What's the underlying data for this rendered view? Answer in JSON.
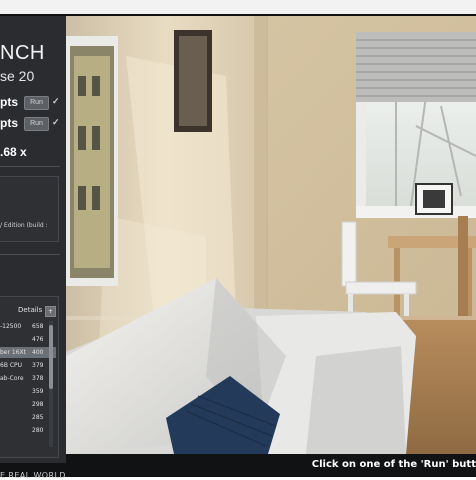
{
  "app": {
    "title_main": "NCH",
    "title_sub": "se 20"
  },
  "scores": [
    {
      "label": "pts",
      "run": "Run"
    },
    {
      "label": "pts",
      "run": "Run"
    }
  ],
  "multiplier": ".68 x",
  "info": {
    "lines": [
      "",
      "",
      "",
      "",
      "/ Edition (build :",
      ""
    ]
  },
  "ranking": {
    "details_label": "Details",
    "toggle": "+",
    "rows": [
      {
        "label": "-12500",
        "value": "658",
        "highlight": false
      },
      {
        "label": "",
        "value": "476",
        "highlight": false
      },
      {
        "label": "ber 16Xt",
        "value": "400",
        "highlight": true
      },
      {
        "label": "6B CPU",
        "value": "379",
        "highlight": false
      },
      {
        "label": "ab-Core",
        "value": "378",
        "highlight": false
      },
      {
        "label": "",
        "value": "359",
        "highlight": false
      },
      {
        "label": "",
        "value": "298",
        "highlight": false
      },
      {
        "label": "",
        "value": "285",
        "highlight": false
      },
      {
        "label": "",
        "value": "280",
        "highlight": false
      }
    ]
  },
  "tagline": "E REAL WORLD",
  "status": "Click on one of the 'Run' butt",
  "icons": {
    "check": "check-icon"
  }
}
